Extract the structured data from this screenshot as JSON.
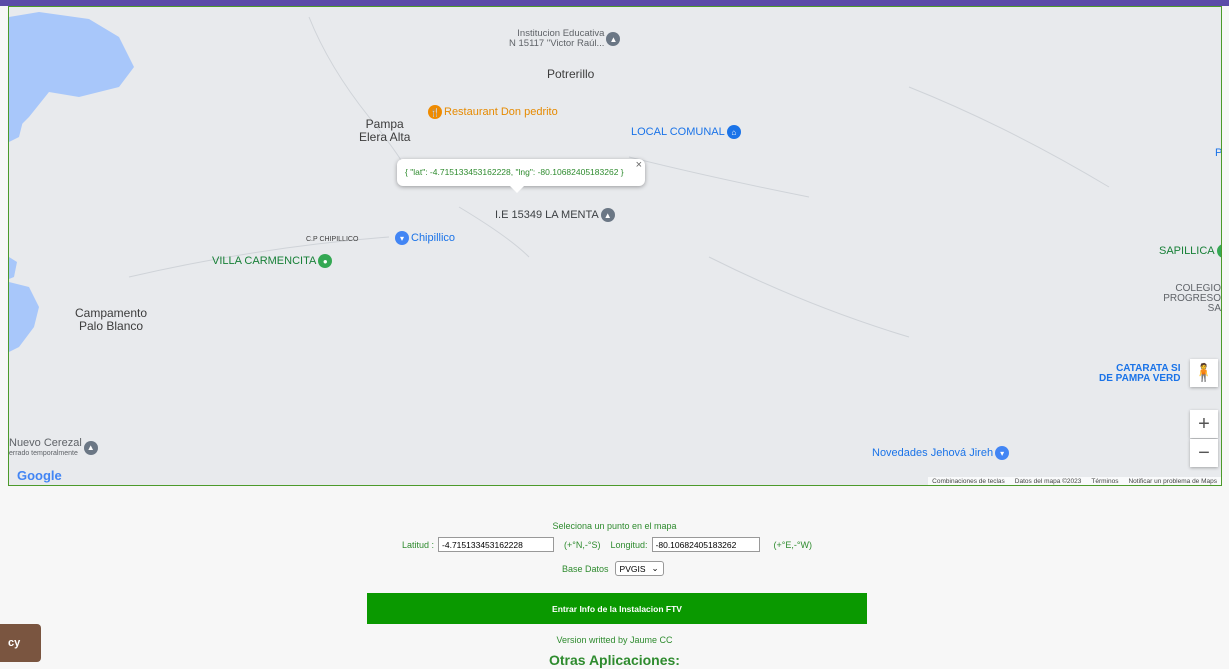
{
  "map": {
    "place_labels": [
      {
        "id": "potrerillo",
        "text": "Potrerillo"
      },
      {
        "id": "pampa-elera",
        "text": "Pampa\nElera Alta"
      },
      {
        "id": "campamento",
        "text": "Campamento\nPalo Blanco"
      },
      {
        "id": "cp-chipillico",
        "text": "C.P CHIPILLICO"
      }
    ],
    "pois": {
      "institucion": "Institucion Educativa\nN 15117 \"Victor Raúl...",
      "restaurant": "Restaurant Don pedrito",
      "local_comunal": "LOCAL COMUNAL",
      "ie_menta": "I.E 15349 LA MENTA",
      "chipillico": "Chipillico",
      "villa": "VILLA CARMENCITA",
      "sapillica": "SAPILLICA",
      "colegio": "COLEGIO\nPROGRESO SA",
      "catarata": "CATARATA SI\nDE PAMPA VERD",
      "nuevo_cerezal": "Nuevo Cerezal",
      "nuevo_cerezal_sub": "errado temporalmente",
      "novedades": "Novedades Jehová Jireh",
      "edge_p": "P"
    },
    "popup_text": "{ \"lat\": -4.715133453162228, \"lng\": -80.10682405183262 }",
    "google_logo": "Google",
    "footer": [
      "Combinaciones de teclas",
      "Datos del mapa ©2023",
      "Términos",
      "Notificar un problema de Maps"
    ],
    "zoom_in": "+",
    "zoom_out": "−"
  },
  "form": {
    "instruction": "Seleciona un punto en el mapa",
    "lat_label": "Latitud :",
    "lat_value": "-4.715133453162228",
    "lat_hint": "(+°N,-°S)",
    "lng_label": "Longitud:",
    "lng_value": "-80.10682405183262",
    "lng_hint": "(+°E,-°W)",
    "db_label": "Base Datos",
    "db_value": "PVGIS",
    "submit_label": "Entrar Info de la Instalacion FTV",
    "version": "Version writted by Jaume CC",
    "other_apps": "Otras Aplicaciones:"
  },
  "privacy_label": "cy"
}
